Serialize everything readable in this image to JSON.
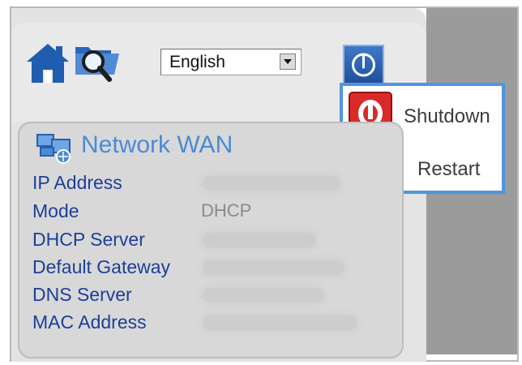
{
  "toolbar": {
    "home_icon": "home-icon",
    "search_folder_icon": "folder-search-icon",
    "language": {
      "selected": "English"
    },
    "power_icon": "power-icon"
  },
  "power_menu": {
    "items": [
      {
        "label": "Shutdown",
        "icon": "shutdown-icon"
      },
      {
        "label": "Restart",
        "icon": "restart-icon"
      }
    ]
  },
  "network_wan": {
    "title": "Network WAN",
    "rows": [
      {
        "label": "IP Address",
        "value": ""
      },
      {
        "label": "Mode",
        "value": "DHCP"
      },
      {
        "label": "DHCP Server",
        "value": ""
      },
      {
        "label": "Default Gateway",
        "value": ""
      },
      {
        "label": "DNS Server",
        "value": ""
      },
      {
        "label": "MAC Address",
        "value": ""
      }
    ]
  },
  "colors": {
    "accent_blue": "#4a8ad6",
    "label_blue": "#1c3f98",
    "menu_border": "#4f95e0",
    "shutdown_red": "#d92a2a",
    "restart_green": "#20a53a"
  }
}
